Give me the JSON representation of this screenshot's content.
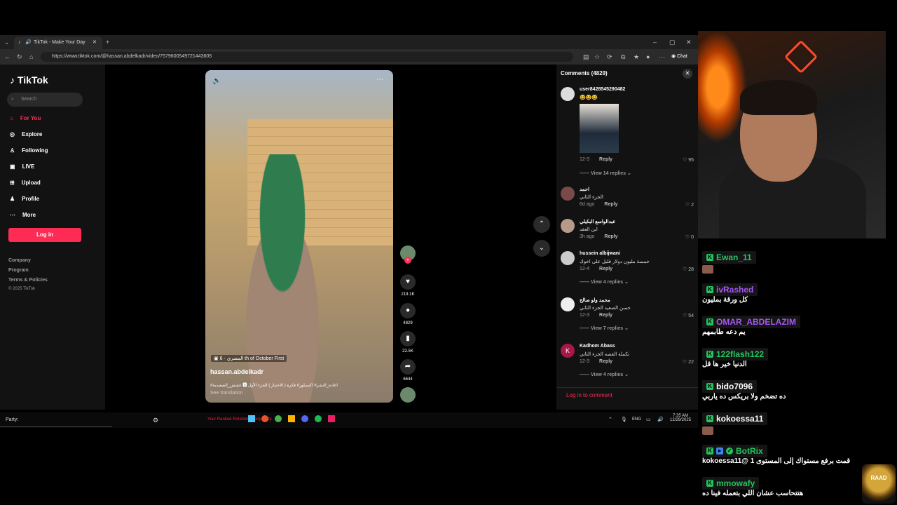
{
  "browser": {
    "tab_title": "TikTok - Make Your Day",
    "new_tab": "+",
    "url": "https://www.tiktok.com/@hassan.abdelkadr/video/7579600549721443605",
    "chat_button": "Chat",
    "window_controls": [
      "–",
      "▢",
      "✕"
    ]
  },
  "tiktok": {
    "logo": "TikTok",
    "search_placeholder": "Search",
    "nav": [
      {
        "label": "For You",
        "icon": "home-icon",
        "active": true
      },
      {
        "label": "Explore",
        "icon": "compass-icon",
        "active": false
      },
      {
        "label": "Following",
        "icon": "user-icon",
        "active": false
      },
      {
        "label": "LIVE",
        "icon": "live-icon",
        "active": false
      },
      {
        "label": "Upload",
        "icon": "plus-icon",
        "active": false
      },
      {
        "label": "Profile",
        "icon": "profile-icon",
        "active": false
      },
      {
        "label": "More",
        "icon": "more-icon",
        "active": false
      }
    ],
    "login_button": "Log in",
    "footer": [
      "Company",
      "Program",
      "Terms & Policies",
      "© 2025 TikTok"
    ]
  },
  "video": {
    "location": "6 · المصري th of October First",
    "author": "hassan.abdelkadr",
    "caption": "#عشش_الصعيدية 🅰 اعادة_النشر# اكسبلور# فكرة ( الاختبار ) الجزء الأول",
    "see_translation": "See translation",
    "likes": "219.1K",
    "comments_count": "4829",
    "saves": "22.5K",
    "shares": "6644"
  },
  "comments": {
    "title": "Comments (4829)",
    "items": [
      {
        "user": "user8428545290482",
        "text": "😂😂😂",
        "date": "12-3",
        "likes": "95",
        "replies": "View 14 replies",
        "has_image": true
      },
      {
        "user": "احمد",
        "text": "الجزء الثاني",
        "date": "6d ago",
        "likes": "2",
        "replies": ""
      },
      {
        "user": "عبدالواسع البكيلي",
        "text": "ابن العقد",
        "date": "3h ago",
        "likes": "0",
        "replies": ""
      },
      {
        "user": "hussein albijwani",
        "text": "خمسة مليون دولار قليل على اخوك",
        "date": "12-4",
        "likes": "28",
        "replies": "View 4 replies"
      },
      {
        "user": "محمد ولو صالح",
        "text": "حسن الصعيد الجزء الثاني",
        "date": "12-3",
        "likes": "54",
        "replies": "View 7 replies"
      },
      {
        "user": "Kadhom Abass",
        "text": "تكملة القصه الجزء الثاني",
        "date": "12-3",
        "likes": "22",
        "replies": "View 4 replies",
        "avatar_letter": "K"
      }
    ],
    "reply_label": "Reply",
    "login_to_comment": "Log in to comment"
  },
  "taskbar": {
    "left_text": "Party:",
    "ticker": "Your Ranked Rotation ... any party.",
    "lang": "ENG",
    "time": "7:35 AM",
    "date": "12/29/2025"
  },
  "chat": [
    {
      "user": "Ewan_11",
      "color": "#22c55e",
      "message": "",
      "emote": true
    },
    {
      "user": "ivRashed",
      "color": "#a855f7",
      "message": "كل ورقة بمليون"
    },
    {
      "user": "OMAR_ABDELAZIM",
      "color": "#a855f7",
      "message": "يم دعه طابمهم"
    },
    {
      "user": "122flash122",
      "color": "#22c55e",
      "message": "الدنيا خير ها قل"
    },
    {
      "user": "bido7096",
      "color": "#ffffff",
      "message": "ده تضخم ولا بريكس ده ياربي"
    },
    {
      "user": "kokoessa11",
      "color": "#ffffff",
      "message": "",
      "emote": true
    },
    {
      "user": "BotRix",
      "color": "#22c55e",
      "message": "قمت برفع مستواك إلى المستوى 1 @kokoessa11"
    },
    {
      "user": "mmowafy",
      "color": "#22c55e",
      "message": "هتتحاسب عشان اللي بتعمله فينا ده"
    }
  ],
  "badge": "RAAD"
}
